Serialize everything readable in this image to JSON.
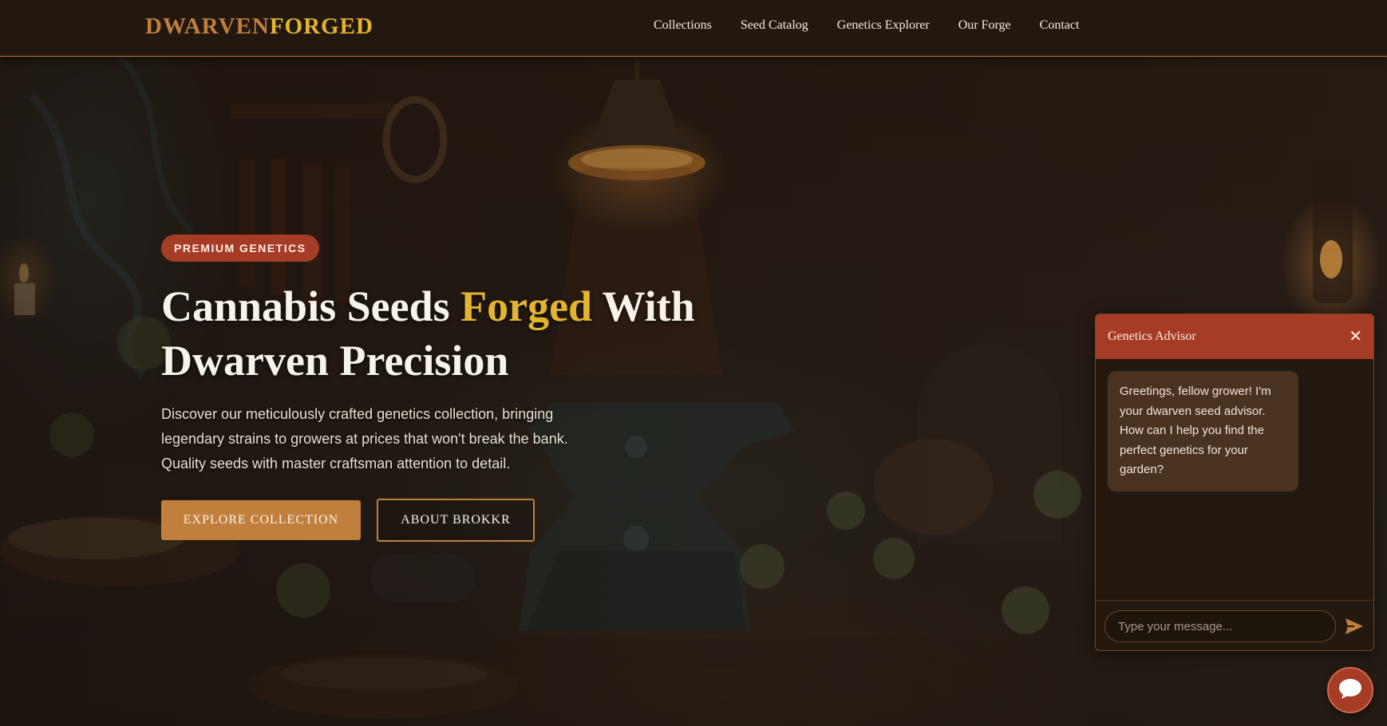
{
  "brand": {
    "part1": "DWARVEN",
    "part2": "FORGED"
  },
  "nav": {
    "links": [
      "Collections",
      "Seed Catalog",
      "Genetics Explorer",
      "Our Forge",
      "Contact"
    ]
  },
  "hero": {
    "badge": "PREMIUM GENETICS",
    "headline": {
      "before": "Cannabis Seeds ",
      "accent": "Forged",
      "after": " With Dwarven Precision"
    },
    "description": "Discover our meticulously crafted genetics collection, bringing legendary strains to growers at prices that won't break the bank. Quality seeds with master craftsman attention to detail.",
    "primary_button": "EXPLORE COLLECTION",
    "secondary_button": "ABOUT BROKKR"
  },
  "chat": {
    "title": "Genetics Advisor",
    "close_icon": "close-icon",
    "messages": [
      {
        "from": "bot",
        "text": "Greetings, fellow grower! I'm your dwarven seed advisor. How can I help you find the perfect genetics for your garden?"
      }
    ],
    "input_placeholder": "Type your message...",
    "send_icon": "send-icon",
    "fab_icon": "chat-bubble-icon"
  },
  "colors": {
    "nav_bg": "#221810",
    "brand_copper": "#c17f3d",
    "brand_gold": "#e3b52f",
    "badge_red": "#a63c26",
    "chat_bubble": "#4a3220"
  }
}
